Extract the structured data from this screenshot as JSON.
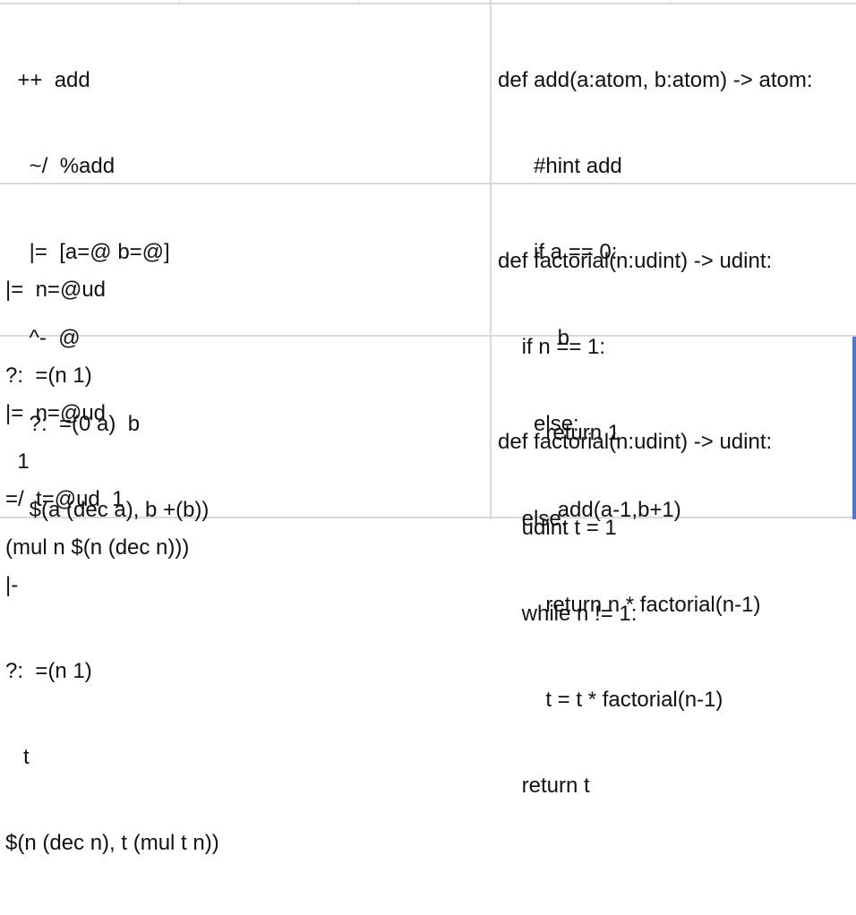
{
  "rows": [
    {
      "hoon": [
        "  ++  add",
        "    ~/  %add",
        "    |=  [a=@ b=@]",
        "    ^-  @",
        "    ?:  =(0 a)  b",
        "    $(a (dec a), b +(b))"
      ],
      "python": [
        "def add(a:atom, b:atom) -> atom:",
        "      #hint add",
        "      if a == 0:",
        "          b",
        "      else:",
        "          add(a-1,b+1)"
      ]
    },
    {
      "hoon": [
        "|=  n=@ud",
        "?:  =(n 1)",
        "  1",
        "(mul n $(n (dec n)))"
      ],
      "python": [
        "def factorial(n:udint) -> udint:",
        "    if n == 1:",
        "        return 1",
        "    else:",
        "        return n * factorial(n-1)"
      ]
    },
    {
      "hoon": [
        "|=  n=@ud",
        "=/  t=@ud  1",
        "|-",
        "?:  =(n 1)",
        "   t",
        "$(n (dec n), t (mul t n))"
      ],
      "python": [
        "def factorial(n:udint) -> udint:",
        "    udint t = 1",
        "    while n != 1:",
        "        t = t * factorial(n-1)",
        "    return t"
      ]
    }
  ],
  "colors": {
    "grid": "#d9d9d9",
    "text": "#111111",
    "selection_edge": "#4a78d6"
  }
}
